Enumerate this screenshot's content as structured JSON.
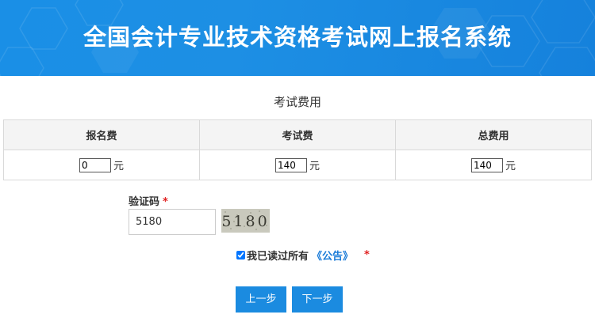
{
  "header": {
    "title": "全国会计专业技术资格考试网上报名系统"
  },
  "section": {
    "title": "考试费用"
  },
  "fees": {
    "columns": [
      "报名费",
      "考试费",
      "总费用"
    ],
    "values": [
      "0",
      "140",
      "140"
    ],
    "unit": "元"
  },
  "captcha": {
    "label": "验证码",
    "required_mark": "*",
    "value": "5180",
    "image_text": "5180"
  },
  "agreement": {
    "text": "我已读过所有",
    "link": "《公告》",
    "required_mark": "*",
    "checked": true
  },
  "buttons": {
    "prev": "上一步",
    "next": "下一步"
  },
  "colors": {
    "header_bg": "#1a8fe6",
    "button_bg": "#1b8be0",
    "link": "#1a7bd8",
    "required": "#e02020"
  }
}
